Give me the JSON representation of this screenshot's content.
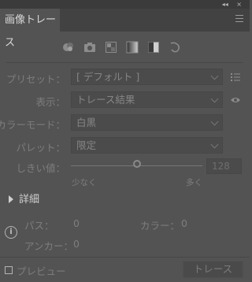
{
  "panel": {
    "tab_title": "画像トレース",
    "collapse_glyph": "◂◂",
    "close_glyph": "×"
  },
  "presets": {
    "icons": [
      "auto-color-icon",
      "high-color-icon",
      "low-color-icon",
      "grayscale-icon",
      "black-and-white-icon",
      "outline-icon"
    ]
  },
  "fields": {
    "preset_label": "プリセット：",
    "preset_value": "[ デフォルト ]",
    "view_label": "表示：",
    "view_value": "トレース結果",
    "mode_label": "カラーモード：",
    "mode_value": "白黒",
    "palette_label": "パレット：",
    "palette_value": "限定",
    "threshold_label": "しきい値：",
    "threshold_value": "128",
    "threshold_level": 128,
    "less_label": "少なく",
    "more_label": "多く"
  },
  "details": {
    "label": "詳細"
  },
  "stats": {
    "paths_label": "パス：",
    "paths_value": "0",
    "colors_label": "カラー：",
    "colors_value": "0",
    "anchors_label": "アンカー：",
    "anchors_value": "0"
  },
  "footer": {
    "preview_label": "プレビュー",
    "trace_button": "トレース"
  },
  "colors": {
    "panel_bg": "#535353",
    "text_disabled": "#7d7d7d",
    "text_active": "#d9d9d9"
  }
}
